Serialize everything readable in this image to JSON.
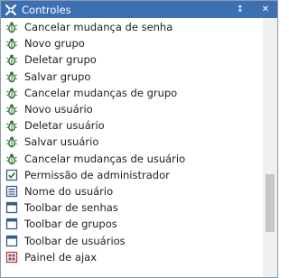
{
  "window": {
    "title": "Controles",
    "pin_glyph": "↕",
    "close_glyph": "✕"
  },
  "items": [
    {
      "label": "Cancelar mudança de senha",
      "icon": "bug-icon"
    },
    {
      "label": "Novo grupo",
      "icon": "bug-icon"
    },
    {
      "label": "Deletar grupo",
      "icon": "bug-icon"
    },
    {
      "label": "Salvar grupo",
      "icon": "bug-icon"
    },
    {
      "label": "Cancelar mudanças de grupo",
      "icon": "bug-icon"
    },
    {
      "label": "Novo usuário",
      "icon": "bug-icon"
    },
    {
      "label": "Deletar usuário",
      "icon": "bug-icon"
    },
    {
      "label": "Salvar usuário",
      "icon": "bug-icon"
    },
    {
      "label": "Cancelar mudanças de usuário",
      "icon": "bug-icon"
    },
    {
      "label": "Permissão de administrador",
      "icon": "checkbox-icon"
    },
    {
      "label": "Nome do usuário",
      "icon": "textbox-icon"
    },
    {
      "label": "Toolbar de senhas",
      "icon": "toolbar-icon"
    },
    {
      "label": "Toolbar de grupos",
      "icon": "toolbar-icon"
    },
    {
      "label": "Toolbar de usuários",
      "icon": "toolbar-icon"
    },
    {
      "label": "Painel de ajax",
      "icon": "ajax-panel-icon"
    }
  ],
  "colors": {
    "titlebar": "#3d6fb3",
    "bug_icon": "#2f6f2f",
    "checkbox_icon": "#3b5a8a",
    "toolbar_icon": "#3b5a8a",
    "ajax_icon": "#c0392b"
  }
}
